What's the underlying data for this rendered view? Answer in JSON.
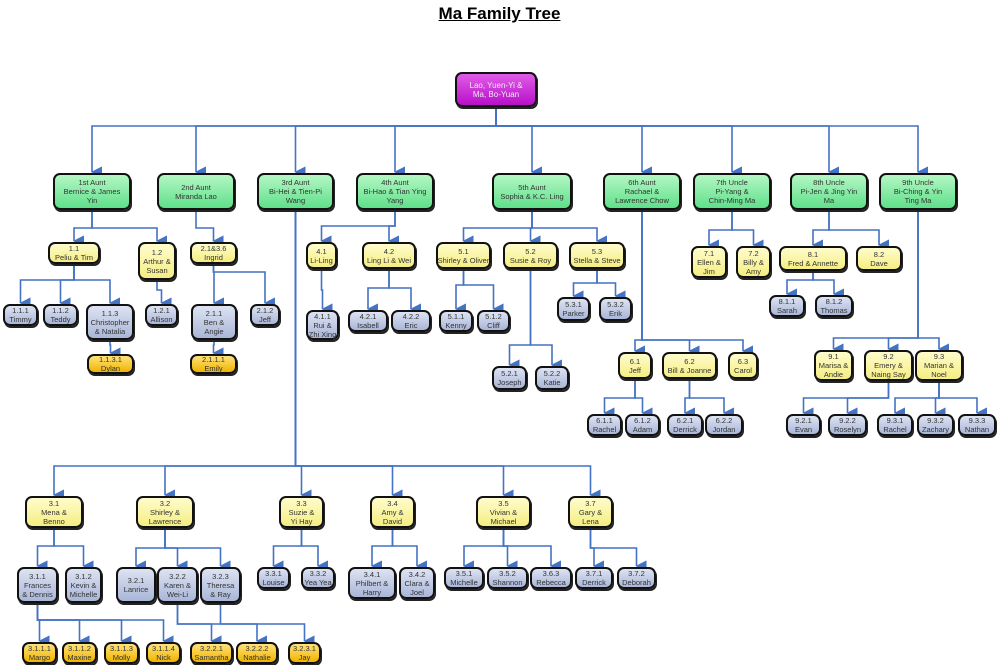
{
  "title": "Ma Family Tree",
  "colors": {
    "root": "#c21fd2",
    "generation_1": "#7ee89c",
    "generation_2": "#f8f29a",
    "generation_3": "#b5c0df",
    "generation_4": "#f5c21a",
    "connector": "#4472c4"
  },
  "nodes": [
    {
      "id": "root",
      "level": 0,
      "lines": [
        "Lao, Yuen-Yi &",
        "Ma, Bo-Yuan"
      ]
    },
    {
      "id": "1",
      "parent": "root",
      "level": 1,
      "lines": [
        "1st Aunt",
        "Bernice & James",
        "Yin"
      ]
    },
    {
      "id": "2",
      "parent": "root",
      "level": 1,
      "lines": [
        "2nd Aunt",
        "Miranda Lao"
      ]
    },
    {
      "id": "3",
      "parent": "root",
      "level": 1,
      "lines": [
        "3rd Aunt",
        "Bi-Hei & Tien-Pi",
        "Wang"
      ]
    },
    {
      "id": "4",
      "parent": "root",
      "level": 1,
      "lines": [
        "4th Aunt",
        "Bi-Hao & Tian Ying",
        "Yang"
      ]
    },
    {
      "id": "5",
      "parent": "root",
      "level": 1,
      "lines": [
        "5th Aunt",
        "Sophia & K.C. Ling"
      ]
    },
    {
      "id": "6",
      "parent": "root",
      "level": 1,
      "lines": [
        "6th Aunt",
        "Rachael &",
        "Lawrence Chow"
      ]
    },
    {
      "id": "7",
      "parent": "root",
      "level": 1,
      "lines": [
        "7th Uncle",
        "Pi-Yang &",
        "Chin-Ming Ma"
      ]
    },
    {
      "id": "8",
      "parent": "root",
      "level": 1,
      "lines": [
        "8th Uncle",
        "Pi-Jen & Jing Yin",
        "Ma"
      ]
    },
    {
      "id": "9",
      "parent": "root",
      "level": 1,
      "lines": [
        "9th Uncle",
        "Bi-Ching & Yin",
        "Ting Ma"
      ]
    },
    {
      "id": "1.1",
      "parent": "1",
      "level": 2,
      "lines": [
        "1.1",
        "Peliu & Tim"
      ]
    },
    {
      "id": "1.2",
      "parent": "1",
      "level": 2,
      "lines": [
        "1.2",
        "Arthur &",
        "Susan"
      ]
    },
    {
      "id": "2.1",
      "parent": "2",
      "level": 2,
      "lines": [
        "2.1&3.6",
        "Ingrid"
      ]
    },
    {
      "id": "4.1",
      "parent": "4",
      "level": 2,
      "lines": [
        "4.1",
        "Li-Ling"
      ]
    },
    {
      "id": "4.2",
      "parent": "4",
      "level": 2,
      "lines": [
        "4.2",
        "Ling Li & Wei"
      ]
    },
    {
      "id": "5.1",
      "parent": "5",
      "level": 2,
      "lines": [
        "5.1",
        "Shirley & Oliver"
      ]
    },
    {
      "id": "5.2",
      "parent": "5",
      "level": 2,
      "lines": [
        "5.2",
        "Susie & Roy"
      ]
    },
    {
      "id": "5.3",
      "parent": "5",
      "level": 2,
      "lines": [
        "5.3",
        "Stella & Steve"
      ]
    },
    {
      "id": "6.1",
      "parent": "6",
      "level": 2,
      "lines": [
        "6.1",
        "Jeff"
      ]
    },
    {
      "id": "6.2",
      "parent": "6",
      "level": 2,
      "lines": [
        "6.2",
        "Bill & Joanne"
      ]
    },
    {
      "id": "6.3",
      "parent": "6",
      "level": 2,
      "lines": [
        "6.3",
        "Carol"
      ]
    },
    {
      "id": "7.1",
      "parent": "7",
      "level": 2,
      "lines": [
        "7.1",
        "Ellen &",
        "Jim"
      ]
    },
    {
      "id": "7.2",
      "parent": "7",
      "level": 2,
      "lines": [
        "7.2",
        "Billy &",
        "Amy"
      ]
    },
    {
      "id": "8.1",
      "parent": "8",
      "level": 2,
      "lines": [
        "8.1",
        "Fred & Annette"
      ]
    },
    {
      "id": "8.2",
      "parent": "8",
      "level": 2,
      "lines": [
        "8.2",
        "Dave"
      ]
    },
    {
      "id": "9.1",
      "parent": "9",
      "level": 2,
      "lines": [
        "9.1",
        "Marisa &",
        "Andie"
      ]
    },
    {
      "id": "9.2",
      "parent": "9",
      "level": 2,
      "lines": [
        "9.2",
        "Emery &",
        "Naing Say"
      ]
    },
    {
      "id": "9.3",
      "parent": "9",
      "level": 2,
      "lines": [
        "9.3",
        "Marian &",
        "Noel"
      ]
    },
    {
      "id": "3.1",
      "parent": "3",
      "level": 2,
      "lines": [
        "3.1",
        "Mena &",
        "Benno"
      ]
    },
    {
      "id": "3.2",
      "parent": "3",
      "level": 2,
      "lines": [
        "3.2",
        "Shirley &",
        "Lawrence"
      ]
    },
    {
      "id": "3.3",
      "parent": "3",
      "level": 2,
      "lines": [
        "3.3",
        "Suzie &",
        "Yi Hay"
      ]
    },
    {
      "id": "3.4",
      "parent": "3",
      "level": 2,
      "lines": [
        "3.4",
        "Amy &",
        "David"
      ]
    },
    {
      "id": "3.5",
      "parent": "3",
      "level": 2,
      "lines": [
        "3.5",
        "Vivian &",
        "Michael"
      ]
    },
    {
      "id": "3.7",
      "parent": "3",
      "level": 2,
      "lines": [
        "3.7",
        "Gary &",
        "Lena"
      ]
    },
    {
      "id": "1.1.1",
      "parent": "1.1",
      "level": 3,
      "lines": [
        "1.1.1",
        "Timmy"
      ]
    },
    {
      "id": "1.1.2",
      "parent": "1.1",
      "level": 3,
      "lines": [
        "1.1.2",
        "Teddy"
      ]
    },
    {
      "id": "1.1.3",
      "parent": "1.1",
      "level": 3,
      "lines": [
        "1.1.3",
        "Christopher",
        "& Natalia"
      ]
    },
    {
      "id": "1.2.1",
      "parent": "1.2",
      "level": 3,
      "lines": [
        "1.2.1",
        "Allison"
      ]
    },
    {
      "id": "2.1.1",
      "parent": "2.1",
      "level": 3,
      "lines": [
        "2.1.1",
        "Ben &",
        "Angie"
      ]
    },
    {
      "id": "2.1.2",
      "parent": "2.1",
      "level": 3,
      "lines": [
        "2.1.2",
        "Jeff"
      ]
    },
    {
      "id": "4.1.1",
      "parent": "4.1",
      "level": 3,
      "lines": [
        "4.1.1",
        "Rui &",
        "Zhi Xing"
      ]
    },
    {
      "id": "4.2.1",
      "parent": "4.2",
      "level": 3,
      "lines": [
        "4.2.1",
        "Isabell"
      ]
    },
    {
      "id": "4.2.2",
      "parent": "4.2",
      "level": 3,
      "lines": [
        "4.2.2",
        "Eric"
      ]
    },
    {
      "id": "5.1.1",
      "parent": "5.1",
      "level": 3,
      "lines": [
        "5.1.1",
        "Kenny"
      ]
    },
    {
      "id": "5.1.2",
      "parent": "5.1",
      "level": 3,
      "lines": [
        "5.1.2",
        "Cliff"
      ]
    },
    {
      "id": "5.2.1",
      "parent": "5.2",
      "level": 3,
      "lines": [
        "5.2.1",
        "Joseph"
      ]
    },
    {
      "id": "5.2.2",
      "parent": "5.2",
      "level": 3,
      "lines": [
        "5.2.2",
        "Katie"
      ]
    },
    {
      "id": "5.3.1",
      "parent": "5.3",
      "level": 3,
      "lines": [
        "5.3.1",
        "Parker"
      ]
    },
    {
      "id": "5.3.2",
      "parent": "5.3",
      "level": 3,
      "lines": [
        "5.3.2",
        "Erik"
      ]
    },
    {
      "id": "6.1.1",
      "parent": "6.1",
      "level": 3,
      "lines": [
        "6.1.1",
        "Rachel"
      ]
    },
    {
      "id": "6.1.2",
      "parent": "6.1",
      "level": 3,
      "lines": [
        "6.1.2",
        "Adam"
      ]
    },
    {
      "id": "6.2.1",
      "parent": "6.2",
      "level": 3,
      "lines": [
        "6.2.1",
        "Derrick"
      ]
    },
    {
      "id": "6.2.2",
      "parent": "6.2",
      "level": 3,
      "lines": [
        "6.2.2",
        "Jordan"
      ]
    },
    {
      "id": "8.1.1",
      "parent": "8.1",
      "level": 3,
      "lines": [
        "8.1.1",
        "Sarah"
      ]
    },
    {
      "id": "8.1.2",
      "parent": "8.1",
      "level": 3,
      "lines": [
        "8.1.2",
        "Thomas"
      ]
    },
    {
      "id": "9.2.1",
      "parent": "9.2",
      "level": 3,
      "lines": [
        "9.2.1",
        "Evan"
      ]
    },
    {
      "id": "9.2.2",
      "parent": "9.2",
      "level": 3,
      "lines": [
        "9.2.2",
        "Roselyn"
      ]
    },
    {
      "id": "9.3.1",
      "parent": "9.3",
      "level": 3,
      "lines": [
        "9.3.1",
        "Rachel"
      ]
    },
    {
      "id": "9.3.2",
      "parent": "9.3",
      "level": 3,
      "lines": [
        "9.3.2",
        "Zachary"
      ]
    },
    {
      "id": "9.3.3",
      "parent": "9.3",
      "level": 3,
      "lines": [
        "9.3.3",
        "Nathan"
      ]
    },
    {
      "id": "3.1.1",
      "parent": "3.1",
      "level": 3,
      "lines": [
        "3.1.1",
        "Frances",
        "& Dennis"
      ]
    },
    {
      "id": "3.1.2",
      "parent": "3.1",
      "level": 3,
      "lines": [
        "3.1.2",
        "Kevin &",
        "Michelle"
      ]
    },
    {
      "id": "3.2.1",
      "parent": "3.2",
      "level": 3,
      "lines": [
        "3.2.1",
        "Lanrice"
      ]
    },
    {
      "id": "3.2.2",
      "parent": "3.2",
      "level": 3,
      "lines": [
        "3.2.2",
        "Karen &",
        "Wei-Li"
      ]
    },
    {
      "id": "3.2.3",
      "parent": "3.2",
      "level": 3,
      "lines": [
        "3.2.3",
        "Theresa",
        "& Ray"
      ]
    },
    {
      "id": "3.3.1",
      "parent": "3.3",
      "level": 3,
      "lines": [
        "3.3.1",
        "Louise"
      ]
    },
    {
      "id": "3.3.2",
      "parent": "3.3",
      "level": 3,
      "lines": [
        "3.3.2",
        "Yea Yea"
      ]
    },
    {
      "id": "3.4.1",
      "parent": "3.4",
      "level": 3,
      "lines": [
        "3.4.1",
        "Philbert &",
        "Harry"
      ]
    },
    {
      "id": "3.4.2",
      "parent": "3.4",
      "level": 3,
      "lines": [
        "3.4.2",
        "Clara &",
        "Joel"
      ]
    },
    {
      "id": "3.5.1",
      "parent": "3.5",
      "level": 3,
      "lines": [
        "3.5.1",
        "Michelle"
      ]
    },
    {
      "id": "3.5.2",
      "parent": "3.5",
      "level": 3,
      "lines": [
        "3.5.2",
        "Shannon"
      ]
    },
    {
      "id": "3.5.3",
      "parent": "3.5",
      "level": 3,
      "lines": [
        "3.6.3",
        "Rebecca"
      ]
    },
    {
      "id": "3.7.1",
      "parent": "3.7",
      "level": 3,
      "lines": [
        "3.7.1",
        "Derrick"
      ]
    },
    {
      "id": "3.7.2",
      "parent": "3.7",
      "level": 3,
      "lines": [
        "3.7.2",
        "Deborah"
      ]
    },
    {
      "id": "1.1.3.1",
      "parent": "1.1.3",
      "level": 4,
      "lines": [
        "1.1.3.1",
        "Dylan"
      ]
    },
    {
      "id": "2.1.1.1",
      "parent": "2.1.1",
      "level": 4,
      "lines": [
        "2.1.1.1",
        "Emily"
      ]
    },
    {
      "id": "3.1.1.1",
      "parent": "3.1.1",
      "level": 4,
      "lines": [
        "3.1.1.1",
        "Margo"
      ]
    },
    {
      "id": "3.1.1.2",
      "parent": "3.1.1",
      "level": 4,
      "lines": [
        "3.1.1.2",
        "Maxine"
      ]
    },
    {
      "id": "3.1.1.3",
      "parent": "3.1.1",
      "level": 4,
      "lines": [
        "3.1.1.3",
        "Molly"
      ]
    },
    {
      "id": "3.1.1.4",
      "parent": "3.1.1",
      "level": 4,
      "lines": [
        "3.1.1.4",
        "Nick"
      ]
    },
    {
      "id": "3.2.2.1",
      "parent": "3.2.2",
      "level": 4,
      "lines": [
        "3.2.2.1",
        "Samantha"
      ]
    },
    {
      "id": "3.2.2.2",
      "parent": "3.2.2",
      "level": 4,
      "lines": [
        "3.2.2.2",
        "Nathalie"
      ]
    },
    {
      "id": "3.2.3.1",
      "parent": "3.2.3",
      "level": 4,
      "lines": [
        "3.2.3.1",
        "Jay"
      ]
    }
  ]
}
